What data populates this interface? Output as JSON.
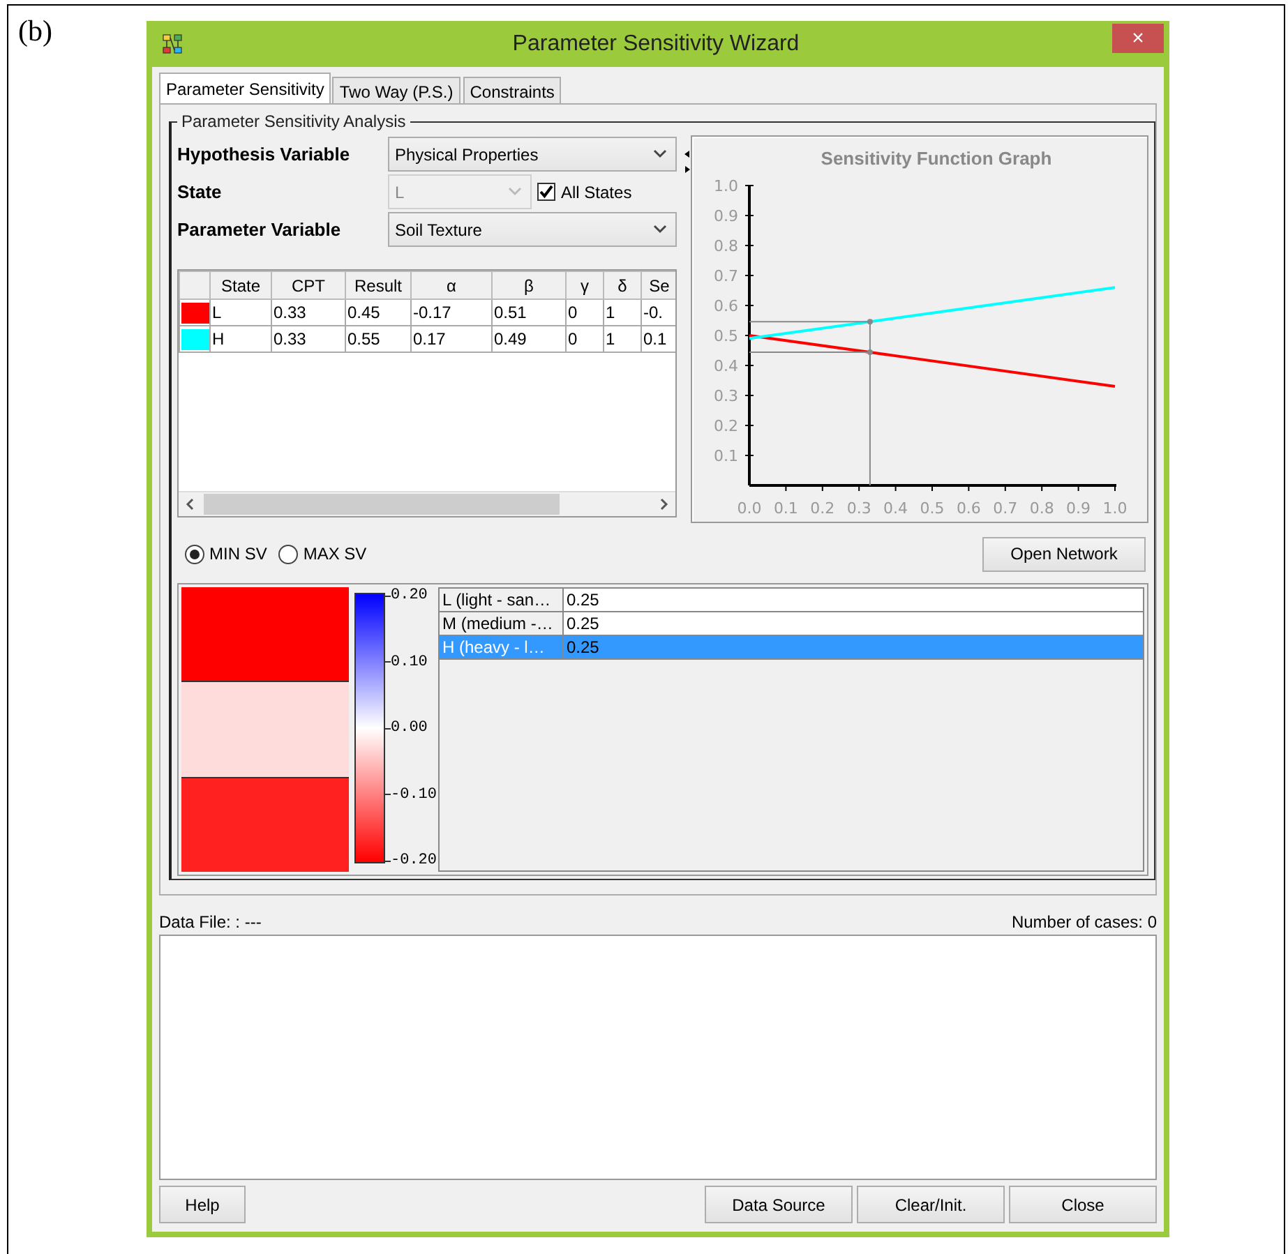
{
  "figure_label": "(b)",
  "window": {
    "title": "Parameter Sensitivity Wizard",
    "close_button": "×"
  },
  "tabs": [
    {
      "label": "Parameter Sensitivity",
      "selected": true
    },
    {
      "label": "Two Way (P.S.)",
      "selected": false
    },
    {
      "label": "Constraints",
      "selected": false
    }
  ],
  "group_title": "Parameter Sensitivity Analysis",
  "form": {
    "hypothesis": {
      "label": "Hypothesis Variable",
      "value": "Physical Properties"
    },
    "state": {
      "label": "State",
      "value": "L",
      "disabled": true
    },
    "all_states": {
      "label": "All States",
      "checked": true
    },
    "parameter": {
      "label": "Parameter Variable",
      "value": "Soil Texture"
    }
  },
  "table": {
    "columns": [
      "State",
      "CPT",
      "Result",
      "α",
      "β",
      "γ",
      "δ",
      "Se"
    ],
    "rows": [
      {
        "color": "#ff0000",
        "cells": [
          "L",
          "0.33",
          "0.45",
          "-0.17",
          "0.51",
          "0",
          "1",
          "-0."
        ]
      },
      {
        "color": "#00ffff",
        "cells": [
          "H",
          "0.33",
          "0.55",
          "0.17",
          "0.49",
          "0",
          "1",
          "0.1"
        ]
      }
    ]
  },
  "chart": {
    "chart_data": {
      "type": "line",
      "title": "Sensitivity Function Graph",
      "x": [
        0,
        1
      ],
      "series": [
        {
          "color": "#ff0000",
          "values": [
            0.5,
            0.33
          ]
        },
        {
          "color": "#00ffff",
          "values": [
            0.49,
            0.66
          ]
        }
      ],
      "xlim": [
        0,
        1
      ],
      "ylim": [
        0,
        1
      ],
      "xticks": [
        {
          "value": 0,
          "label": "0.0"
        },
        {
          "value": 0.1,
          "label": "0.1"
        },
        {
          "value": 0.2,
          "label": "0.2"
        },
        {
          "value": 0.3,
          "label": "0.3"
        },
        {
          "value": 0.4,
          "label": "0.4"
        },
        {
          "value": 0.5,
          "label": "0.5"
        },
        {
          "value": 0.6,
          "label": "0.6"
        },
        {
          "value": 0.7,
          "label": "0.7"
        },
        {
          "value": 0.8,
          "label": "0.8"
        },
        {
          "value": 0.9,
          "label": "0.9"
        },
        {
          "value": 1,
          "label": "1.0"
        }
      ],
      "yticks": [
        {
          "value": 0.1,
          "label": "0.1"
        },
        {
          "value": 0.2,
          "label": "0.2"
        },
        {
          "value": 0.3,
          "label": "0.3"
        },
        {
          "value": 0.4,
          "label": "0.4"
        },
        {
          "value": 0.5,
          "label": "0.5"
        },
        {
          "value": 0.6,
          "label": "0.6"
        },
        {
          "value": 0.7,
          "label": "0.7"
        },
        {
          "value": 0.8,
          "label": "0.8"
        },
        {
          "value": 0.9,
          "label": "0.9"
        },
        {
          "value": 1,
          "label": "1.0"
        }
      ],
      "ref_lines": [
        {
          "axis": "x",
          "value": 0.33
        }
      ]
    }
  },
  "sv_options": [
    {
      "label": "MIN SV",
      "selected": true
    },
    {
      "label": "MAX SV",
      "selected": false
    }
  ],
  "open_network_button": "Open Network",
  "heatmap": {
    "cells": [
      {
        "color": "#ff0000"
      },
      {
        "color": "#ffdcdc"
      },
      {
        "color": "#ff2020"
      }
    ],
    "scale_labels": [
      "0.20",
      "0.10",
      "0.00",
      "-0.10",
      "-0.20"
    ]
  },
  "state_values": [
    {
      "state": "L (light - san…",
      "value": "0.25",
      "selected": false
    },
    {
      "state": "M (medium -…",
      "value": "0.25",
      "selected": false
    },
    {
      "state": "H (heavy - l…",
      "value": "0.25",
      "selected": true
    }
  ],
  "data_file": {
    "label": "Data File: : ---",
    "cases": "Number of cases: 0"
  },
  "buttons": {
    "left": [
      "Help"
    ],
    "right": [
      "Data Source",
      "Clear/Init.",
      "Close"
    ]
  }
}
